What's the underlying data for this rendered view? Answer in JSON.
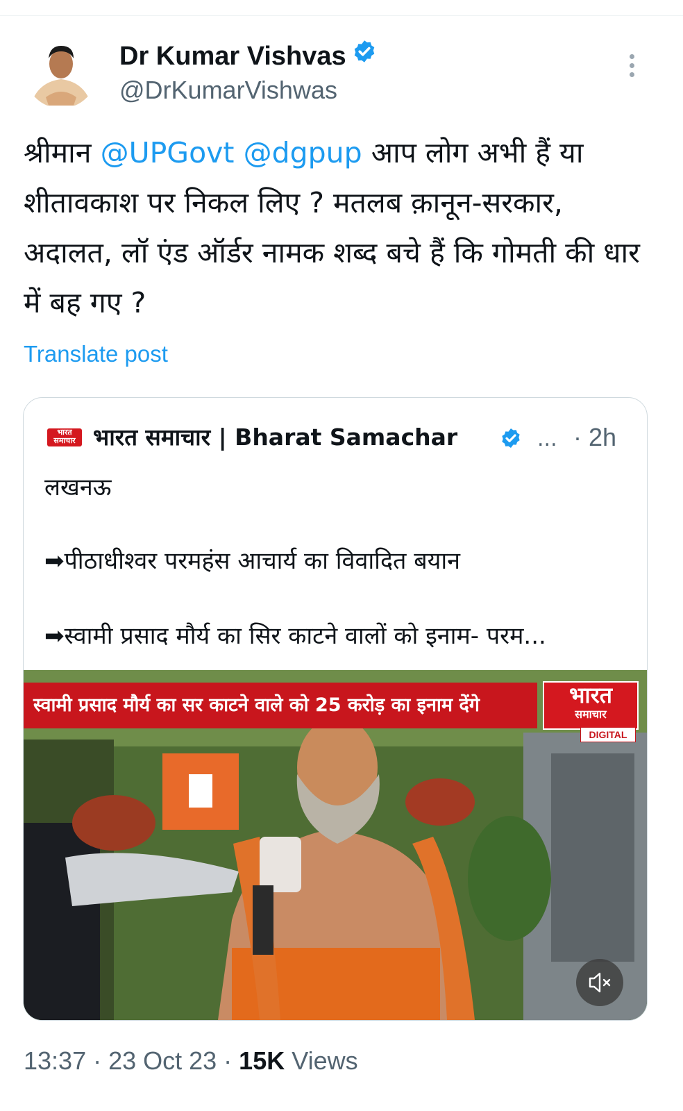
{
  "author": {
    "name": "Dr Kumar Vishvas",
    "handle": "@DrKumarVishwas",
    "verified_icon": "verified-badge-icon",
    "menu_icon": "more-vertical-icon"
  },
  "tweet": {
    "text_parts": {
      "p1": "श्रीमान ",
      "m1": "@UPGovt",
      "p2": " ",
      "m2": "@dgpup",
      "p3": " आप लोग अभी हैं या शीतावकाश पर निकल लिए ? मतलब क़ानून-सरकार, अदालत, लॉ एंड ऑर्डर नामक शब्द बचे हैं कि गोमती की धार में बह गए ?"
    },
    "translate_label": "Translate post"
  },
  "quote": {
    "logo_text": "भारत समाचार",
    "name": "भारत समाचार | Bharat Samachar",
    "ellipsis": "...",
    "time": "· 2h",
    "lines": {
      "l1": "लखनऊ",
      "l2": "➡पीठाधीश्वर परमहंस आचार्य का विवादित बयान",
      "l3": "➡स्वामी प्रसाद मौर्य का सिर काटने वालों को इनाम- परम..."
    },
    "video": {
      "banner": "स्वामी प्रसाद मौर्य का सर काटने वाले को  25 करोड़ का इनाम देंगे",
      "channel_big": "भारत",
      "channel_small": "समाचार",
      "digital": "DIGITAL",
      "mute_icon": "mute-icon"
    }
  },
  "footer": {
    "time": "13:37 · 23 Oct 23 · ",
    "views_count": "15K",
    "views_label": " Views"
  },
  "colors": {
    "accent": "#1d9bf0",
    "secondary_text": "#536471",
    "brand_red": "#c8161d"
  }
}
